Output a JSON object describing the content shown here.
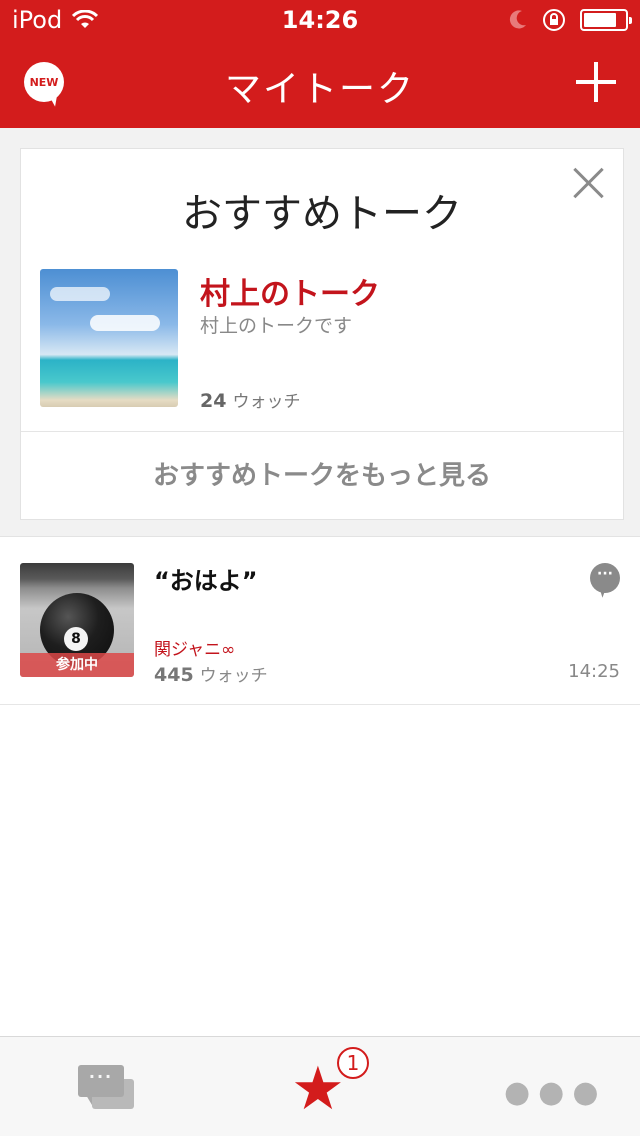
{
  "status_bar": {
    "carrier": "iPod",
    "time": "14:26",
    "battery_level": 0.8
  },
  "header": {
    "title": "マイトーク",
    "new_badge_label": "NEW",
    "add_icon": "plus-icon"
  },
  "recommended": {
    "heading": "おすすめトーク",
    "close_icon": "close-icon",
    "item": {
      "title": "村上のトーク",
      "description": "村上のトークです",
      "watch_count": "24",
      "watch_label": "ウォッチ"
    },
    "more_label": "おすすめトークをもっと見る"
  },
  "talks": [
    {
      "title": "“おはよ”",
      "group": "関ジャニ∞",
      "watch_count": "445",
      "watch_label": "ウォッチ",
      "time": "14:25",
      "joined_label": "参加中",
      "chat_icon": "speech-bubble-icon"
    }
  ],
  "tab_bar": {
    "tabs": [
      {
        "name": "talks",
        "icon": "chat-bubbles-icon"
      },
      {
        "name": "favorites",
        "icon": "star-icon",
        "badge": "1"
      },
      {
        "name": "more",
        "icon": "more-dots-icon"
      }
    ]
  },
  "colors": {
    "brand_red": "#d31c1c",
    "title_red": "#c3141c"
  }
}
